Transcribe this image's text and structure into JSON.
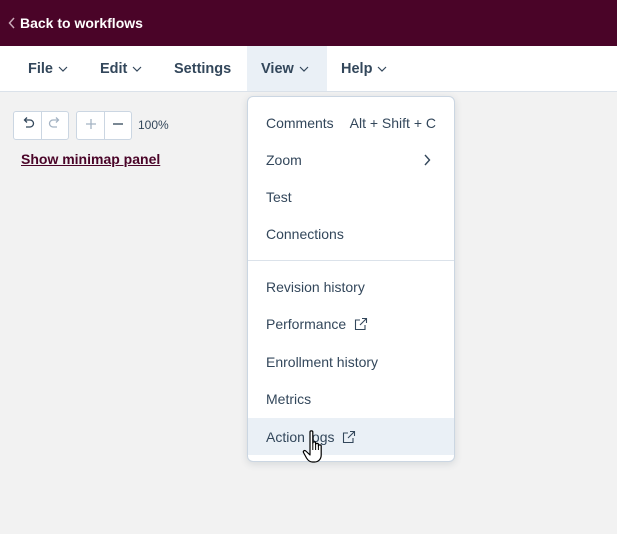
{
  "topbar": {
    "back_label": "Back to workflows",
    "background": "#4a0428"
  },
  "menubar": {
    "items": [
      {
        "label": "File",
        "has_caret": true
      },
      {
        "label": "Edit",
        "has_caret": true
      },
      {
        "label": "Settings",
        "has_caret": false
      },
      {
        "label": "View",
        "has_caret": true,
        "active": true
      },
      {
        "label": "Help",
        "has_caret": true
      }
    ]
  },
  "toolbar": {
    "undo_icon": "undo-icon",
    "redo_icon": "redo-icon",
    "zoom_in_icon": "plus-icon",
    "zoom_out_icon": "minus-icon",
    "zoom_level": "100%",
    "minimap_link": "Show minimap panel"
  },
  "view_menu": {
    "items": [
      {
        "label": "Comments",
        "shortcut": "Alt + Shift + C"
      },
      {
        "label": "Zoom",
        "submenu": true
      },
      {
        "label": "Test"
      },
      {
        "label": "Connections"
      },
      {
        "label": "Revision history"
      },
      {
        "label": "Performance",
        "external": true
      },
      {
        "label": "Enrollment history"
      },
      {
        "label": "Metrics"
      },
      {
        "label": "Action logs",
        "external": true,
        "hovered": true
      }
    ]
  },
  "colors": {
    "accent": "#4a0428",
    "text": "#33475b",
    "hover": "#eaf0f6",
    "border": "#cbd6e2"
  }
}
